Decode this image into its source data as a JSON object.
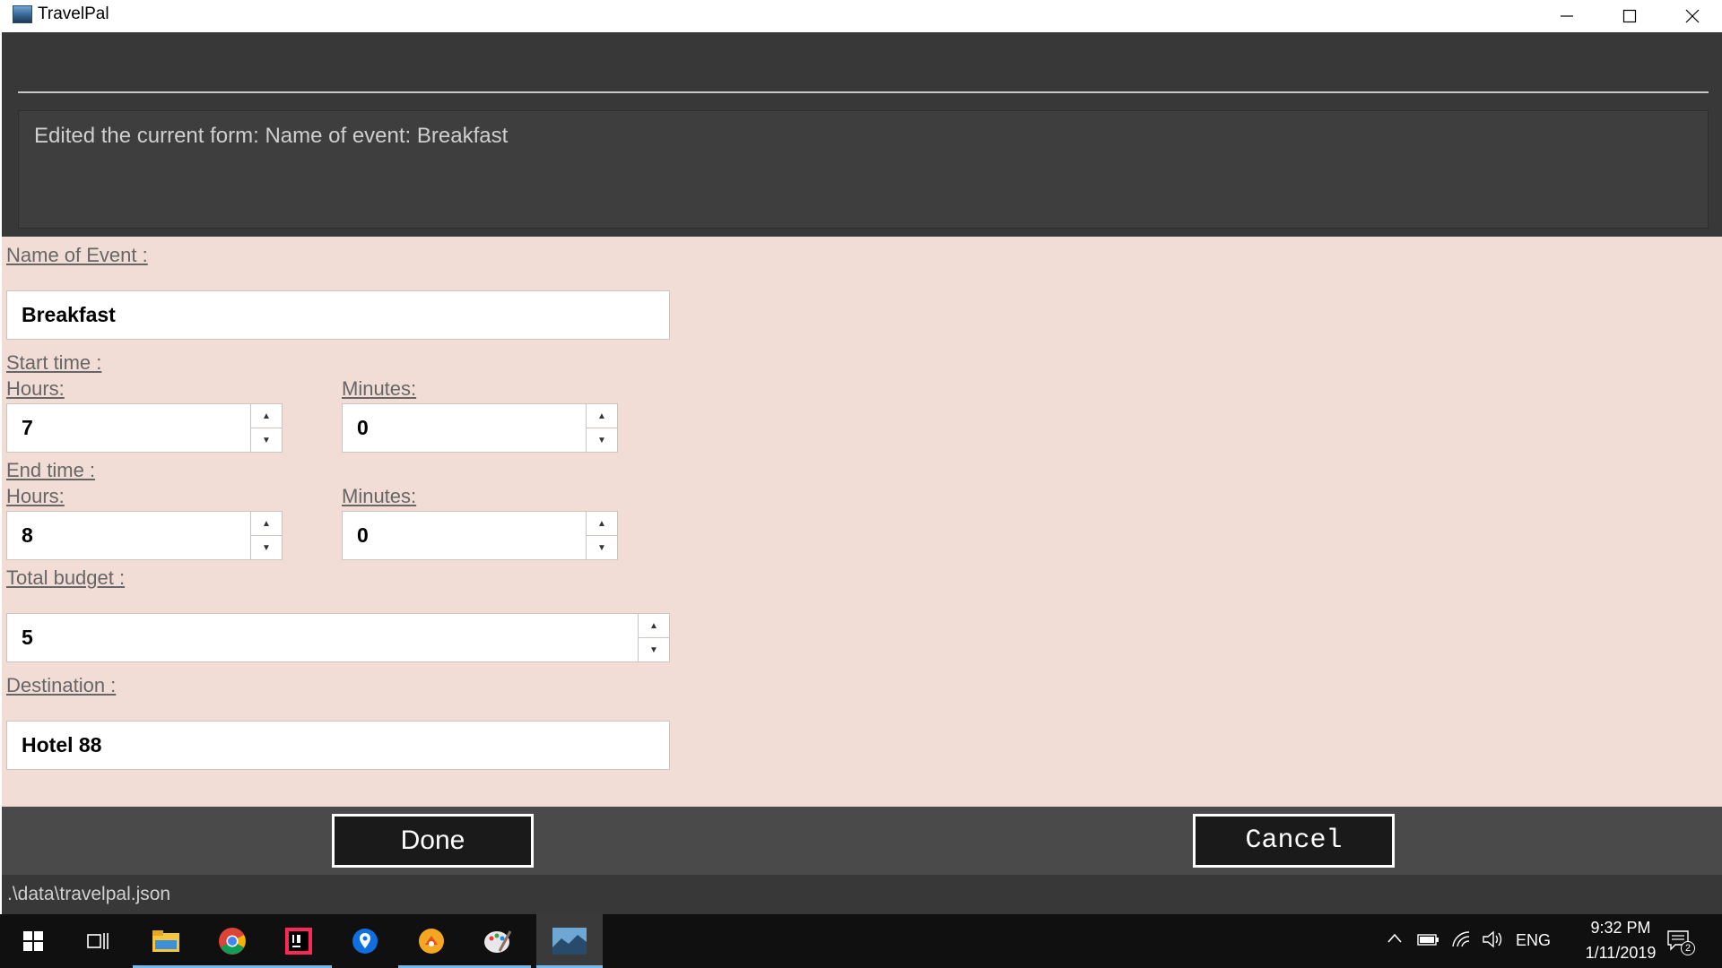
{
  "window": {
    "title": "TravelPal"
  },
  "result_display": {
    "text": "Edited the current form: Name of event: Breakfast"
  },
  "form": {
    "name_label": "Name of Event :",
    "name_value": "Breakfast",
    "start_label": "Start time :",
    "start_hours_label": "Hours:",
    "start_hours_value": "7",
    "start_minutes_label": "Minutes:",
    "start_minutes_value": "0",
    "end_label": "End time :",
    "end_hours_label": "Hours:",
    "end_hours_value": "8",
    "end_minutes_label": "Minutes:",
    "end_minutes_value": "0",
    "budget_label": "Total budget :",
    "budget_value": "5",
    "destination_label": "Destination :",
    "destination_value": "Hotel 88"
  },
  "buttons": {
    "done": "Done",
    "cancel": "Cancel"
  },
  "status": {
    "file_path": ".\\data\\travelpal.json"
  },
  "taskbar": {
    "language": "ENG",
    "time": "9:32 PM",
    "date": "1/11/2019",
    "notification_count": "2",
    "apps": [
      "start-icon",
      "task-view-icon",
      "file-explorer-icon",
      "chrome-icon",
      "intellij-icon",
      "maps-icon",
      "photos-icon",
      "paint-icon",
      "travelpal-icon"
    ]
  }
}
